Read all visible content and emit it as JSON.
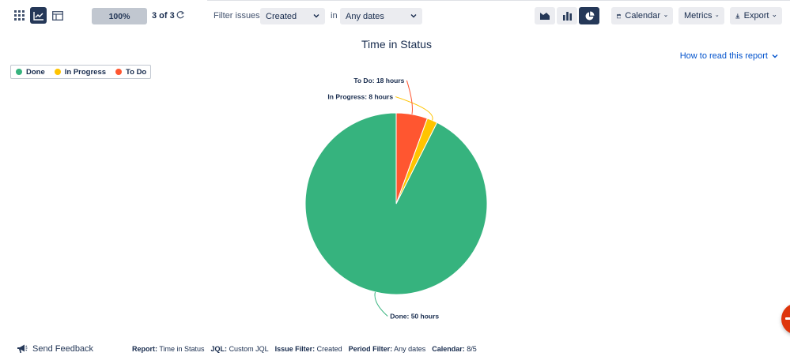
{
  "toolbar": {
    "view_icons": [
      "grid-icon",
      "line-chart-icon",
      "table-icon"
    ],
    "progress": "100%",
    "counter": "3 of 3",
    "filter_label": "Filter issues:",
    "filter_value": "Created",
    "in_label": "in",
    "period_value": "Any dates",
    "chart_types": [
      "area-chart-icon",
      "bar-chart-icon",
      "pie-chart-icon"
    ],
    "calendar_label": "Calendar",
    "metrics_label": "Metrics",
    "export_label": "Export"
  },
  "report": {
    "title": "Time in Status",
    "howto_label": "How to read this report"
  },
  "chart_data": {
    "type": "pie",
    "title": "Time in Status",
    "slices": [
      {
        "name": "Done",
        "value": 50,
        "label": "Done: 50 hours",
        "color": "#36b37e"
      },
      {
        "name": "In Progress",
        "value": 1,
        "label": "In Progress: 8 hours",
        "color": "#ffc400"
      },
      {
        "name": "To Do",
        "value": 3,
        "label": "To Do: 18 hours",
        "color": "#ff5630"
      }
    ],
    "legend": [
      "Done",
      "In Progress",
      "To Do"
    ],
    "legend_position": "top-left"
  },
  "footer": {
    "feedback_label": "Send Feedback",
    "report_key": "Report:",
    "report_val": "Time in Status",
    "jql_key": "JQL:",
    "jql_val": "Custom JQL",
    "issue_key": "Issue Filter:",
    "issue_val": "Created",
    "period_key": "Period Filter:",
    "period_val": "Any dates",
    "calendar_key": "Calendar:",
    "calendar_val": "8/5"
  }
}
